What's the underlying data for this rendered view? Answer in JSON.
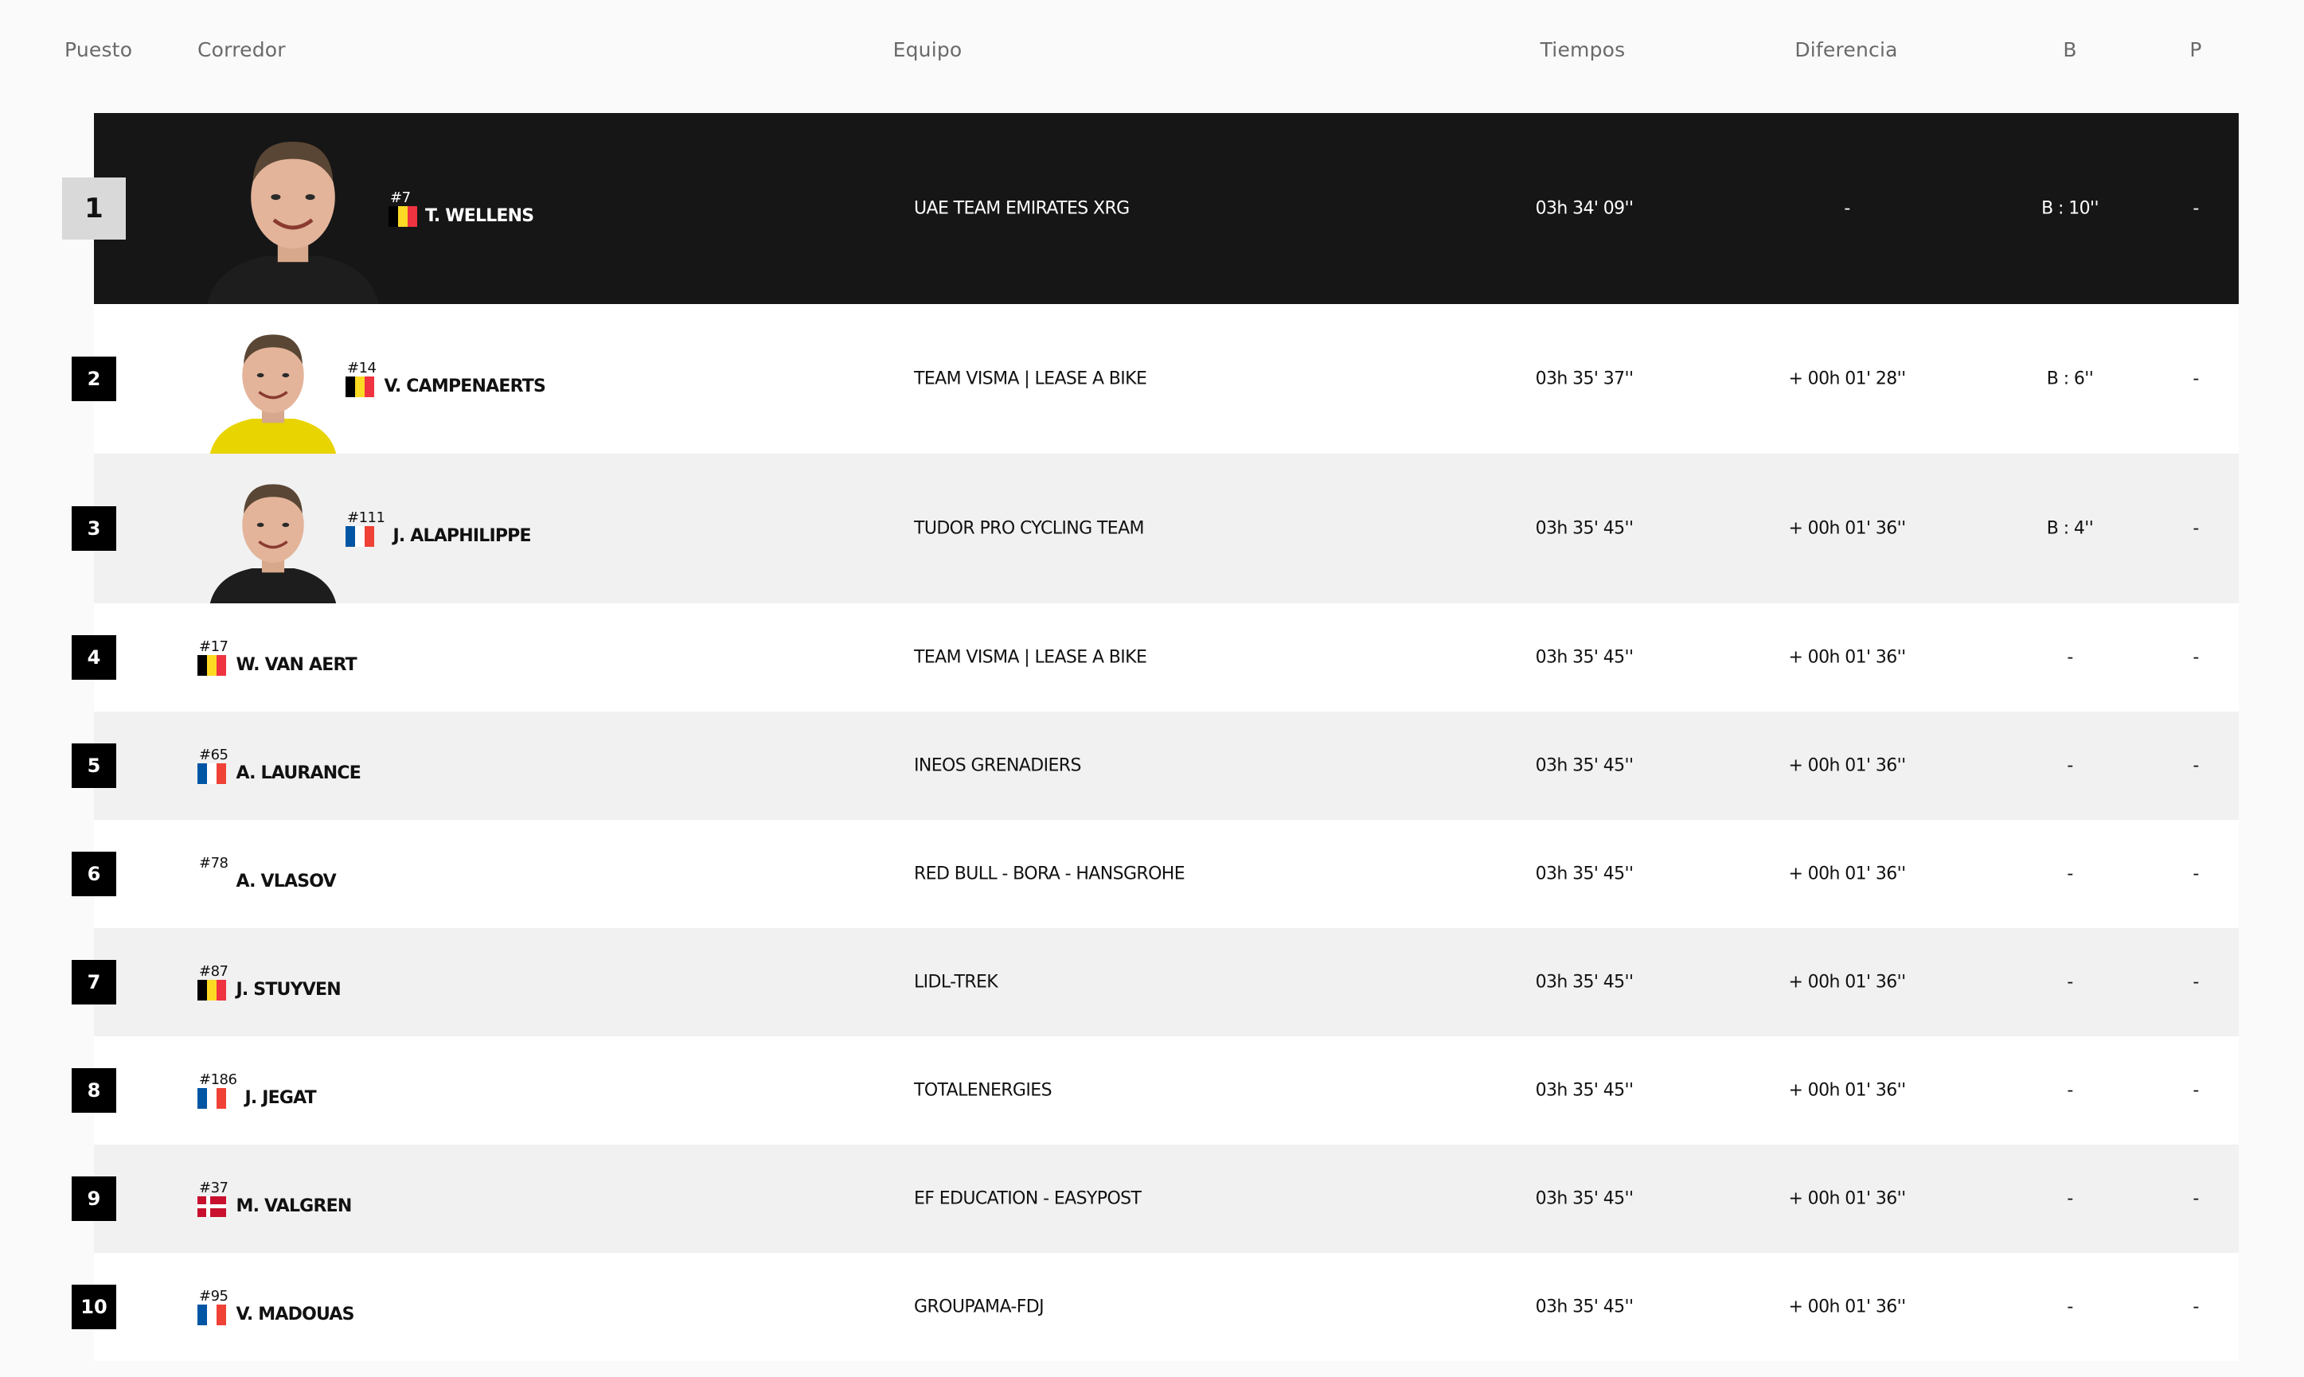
{
  "headers": {
    "position": "Puesto",
    "rider": "Corredor",
    "team": "Equipo",
    "time": "Tiempos",
    "gap": "Diferencia",
    "bonus": "B",
    "penalty": "P"
  },
  "colors": {
    "leader_row_bg": "#161616",
    "alt_row_bg": "#f1f1f1",
    "rank_badge_bg": "#000000",
    "leader_rank_bg": "#d9d9d9"
  },
  "rows": [
    {
      "rank": "1",
      "bib": "#7",
      "flag": "belgium-flag-icon",
      "name": "T. WELLENS",
      "team": "UAE TEAM EMIRATES XRG",
      "time": "03h 34' 09''",
      "gap": "-",
      "bonus": "B : 10''",
      "penalty": "-"
    },
    {
      "rank": "2",
      "bib": "#14",
      "flag": "belgium-flag-icon",
      "name": "V. CAMPENAERTS",
      "team": "TEAM VISMA | LEASE A BIKE",
      "time": "03h 35' 37''",
      "gap": "+ 00h 01' 28''",
      "bonus": "B : 6''",
      "penalty": "-"
    },
    {
      "rank": "3",
      "bib": "#111",
      "flag": "france-flag-icon",
      "name": "J. ALAPHILIPPE",
      "team": "TUDOR PRO CYCLING TEAM",
      "time": "03h 35' 45''",
      "gap": "+ 00h 01' 36''",
      "bonus": "B : 4''",
      "penalty": "-"
    },
    {
      "rank": "4",
      "bib": "#17",
      "flag": "belgium-flag-icon",
      "name": "W. VAN AERT",
      "team": "TEAM VISMA | LEASE A BIKE",
      "time": "03h 35' 45''",
      "gap": "+ 00h 01' 36''",
      "bonus": "-",
      "penalty": "-"
    },
    {
      "rank": "5",
      "bib": "#65",
      "flag": "france-flag-icon",
      "name": "A. LAURANCE",
      "team": "INEOS GRENADIERS",
      "time": "03h 35' 45''",
      "gap": "+ 00h 01' 36''",
      "bonus": "-",
      "penalty": "-"
    },
    {
      "rank": "6",
      "bib": "#78",
      "flag": "",
      "name": "A. VLASOV",
      "team": "RED BULL - BORA - HANSGROHE",
      "time": "03h 35' 45''",
      "gap": "+ 00h 01' 36''",
      "bonus": "-",
      "penalty": "-"
    },
    {
      "rank": "7",
      "bib": "#87",
      "flag": "belgium-flag-icon",
      "name": "J. STUYVEN",
      "team": "LIDL-TREK",
      "time": "03h 35' 45''",
      "gap": "+ 00h 01' 36''",
      "bonus": "-",
      "penalty": "-"
    },
    {
      "rank": "8",
      "bib": "#186",
      "flag": "france-flag-icon",
      "name": "J. JEGAT",
      "team": "TOTALENERGIES",
      "time": "03h 35' 45''",
      "gap": "+ 00h 01' 36''",
      "bonus": "-",
      "penalty": "-"
    },
    {
      "rank": "9",
      "bib": "#37",
      "flag": "denmark-flag-icon",
      "name": "M. VALGREN",
      "team": "EF EDUCATION - EASYPOST",
      "time": "03h 35' 45''",
      "gap": "+ 00h 01' 36''",
      "bonus": "-",
      "penalty": "-"
    },
    {
      "rank": "10",
      "bib": "#95",
      "flag": "france-flag-icon",
      "name": "V. MADOUAS",
      "team": "GROUPAMA-FDJ",
      "time": "03h 35' 45''",
      "gap": "+ 00h 01' 36''",
      "bonus": "-",
      "penalty": "-"
    }
  ]
}
